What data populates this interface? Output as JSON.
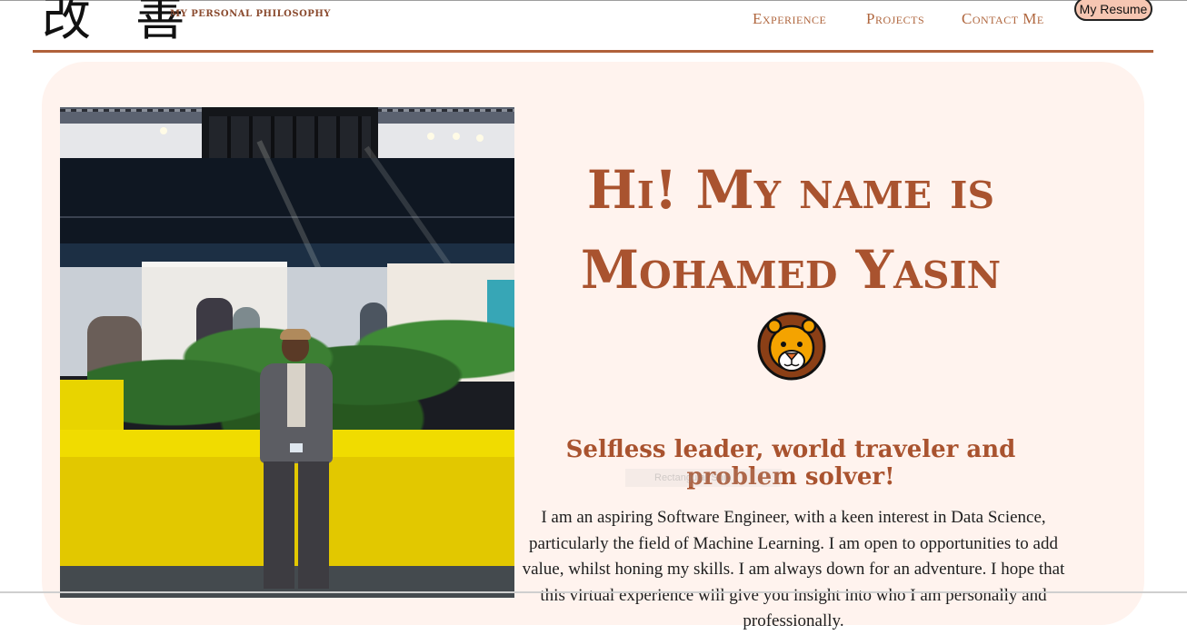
{
  "header": {
    "logo_kanji": "改 善",
    "logo_subtitle": "MY PERSONAL PHILOSOPHY",
    "nav": [
      {
        "label": "Experience"
      },
      {
        "label": "Projects"
      },
      {
        "label": "Contact Me"
      }
    ],
    "resume_button": "My Resume"
  },
  "hero": {
    "title_line1": "Hi! My name is",
    "title_line2": "Mohamed Yasin",
    "emoji": "lion-face",
    "tagline": "Selfless leader, world traveler and problem solver!",
    "bio": "I am an aspiring Software Engineer, with a keen interest in Data Science, particularly the field of Machine Learning. I am open to opportunities to add value, whilst honing my skills. I am always down for an adventure. I hope that this virtual experience will give you insight into who I am personally and professionally.",
    "overlay_hint": "Rectangular Snip"
  },
  "colors": {
    "accent": "#a9532f",
    "card_bg": "#fff3ee",
    "button_bg": "#f6c6b2"
  }
}
